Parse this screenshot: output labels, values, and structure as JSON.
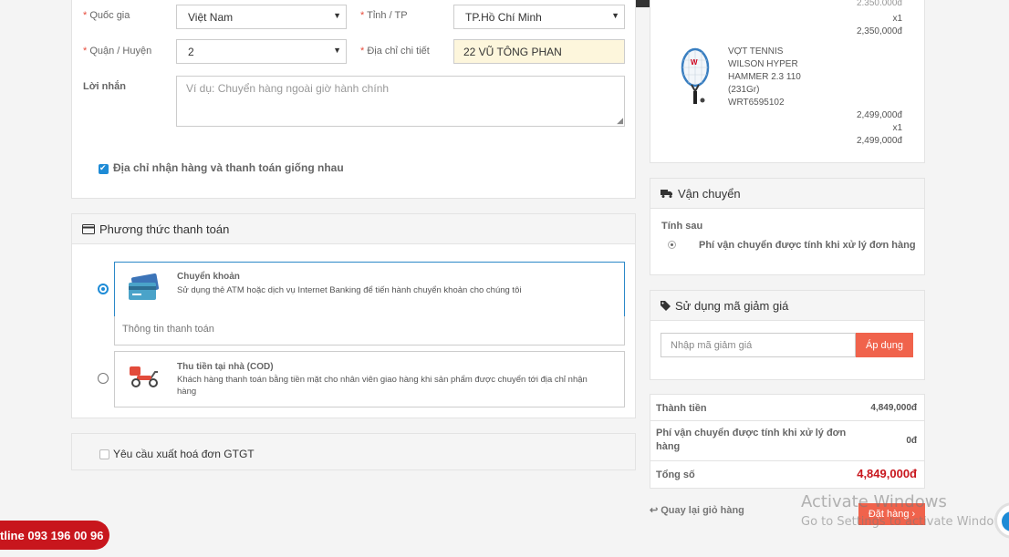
{
  "address": {
    "country_label": "Quốc gia",
    "country_value": "Việt Nam",
    "province_label": "Tỉnh / TP",
    "province_value": "TP.Hồ Chí Minh",
    "district_label": "Quận / Huyện",
    "district_value": "2",
    "detail_label": "Địa chỉ chi tiết",
    "detail_value": "22 VŨ TÔNG PHAN",
    "message_label": "Lời nhắn",
    "message_placeholder": "Ví dụ: Chuyển hàng ngoài giờ hành chính",
    "same_address_label": "Địa chỉ nhận hàng và thanh toán giống nhau",
    "same_address_checked": true
  },
  "payment": {
    "title": "Phương thức thanh toán",
    "methods": [
      {
        "title": "Chuyển khoản",
        "desc": "Sử dụng thẻ ATM hoặc dịch vụ Internet Banking để tiến hành chuyển khoản cho chúng tôi",
        "selected": true,
        "icon": "credit-card-icon"
      },
      {
        "title": "Thu tiền tại nhà (COD)",
        "desc": "Khách hàng thanh toán bằng tiền mặt cho nhân viên giao hàng khi sản phẩm được chuyển tới địa chỉ nhận hàng",
        "selected": false,
        "icon": "scooter-icon"
      }
    ],
    "info_label": "Thông tin thanh toán"
  },
  "invoice": {
    "label": "Yêu cầu xuất hoá đơn GTGT",
    "checked": false
  },
  "cart": {
    "prev_item": {
      "qty": "x1",
      "total": "2,350,000đ"
    },
    "item": {
      "name_lines": [
        "VỢT TENNIS",
        "WILSON HYPER",
        "HAMMER 2.3 110",
        "(231Gr)",
        "WRT6595102"
      ],
      "price": "2,499,000đ",
      "qty": "x1",
      "total": "2,499,000đ"
    }
  },
  "shipping": {
    "title": "Vận chuyển",
    "subtitle": "Tính sau",
    "option": "Phí vận chuyển được tính khi xử lý đơn hàng"
  },
  "coupon": {
    "title": "Sử dụng mã giảm giá",
    "placeholder": "Nhập mã giảm giá",
    "apply": "Áp dụng"
  },
  "summary": {
    "subtotal_label": "Thành tiền",
    "subtotal_value": "4,849,000đ",
    "shipping_label": "Phí vận chuyển được tính khi xử lý đơn hàng",
    "shipping_value": "0đ",
    "total_label": "Tổng số",
    "total_value": "4,849,000đ"
  },
  "actions": {
    "back": "Quay lại giỏ hàng",
    "order": "Đặt hàng"
  },
  "hotline": "tline 093 196 00 96",
  "watermark": {
    "line1": "Activate Windows",
    "line2": "Go to Settings to activate Windows."
  },
  "colors": {
    "accent": "#1e8bd6",
    "danger": "#f0634c",
    "total": "#c8161d"
  }
}
